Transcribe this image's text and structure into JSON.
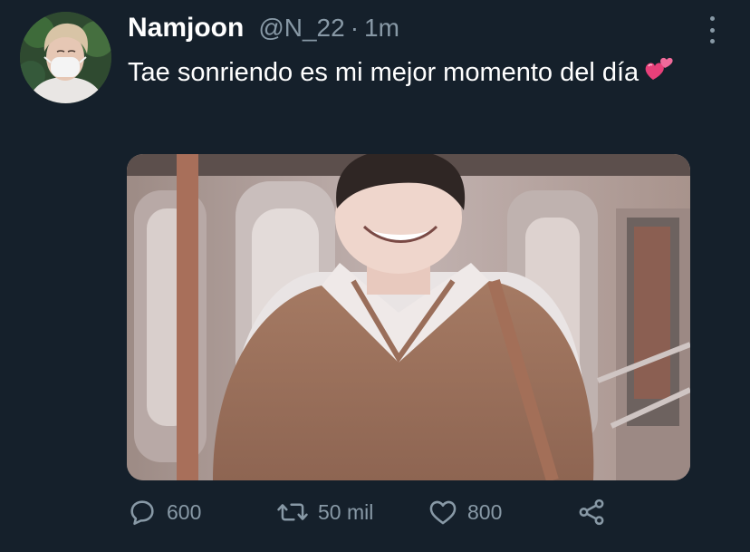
{
  "tweet": {
    "display_name": "Namjoon",
    "handle": "@N_22",
    "separator": "·",
    "time": "1m",
    "text": "Tae sonriendo es mi mejor momento del día",
    "text_emoji": "two-hearts-emoji",
    "avatar": "profile-photo-person-with-mask",
    "media": "photo-person-smiling-in-subway"
  },
  "actions": {
    "reply_count": "600",
    "retweet_count": "50 mil",
    "like_count": "800",
    "reply_icon": "speech-bubble-icon",
    "retweet_icon": "retweet-arrows-icon",
    "like_icon": "heart-icon",
    "share_icon": "share-icon"
  },
  "colors": {
    "background": "#15202b",
    "text": "#ffffff",
    "muted": "#8899a6",
    "emoji_pink": "#e8407a"
  }
}
